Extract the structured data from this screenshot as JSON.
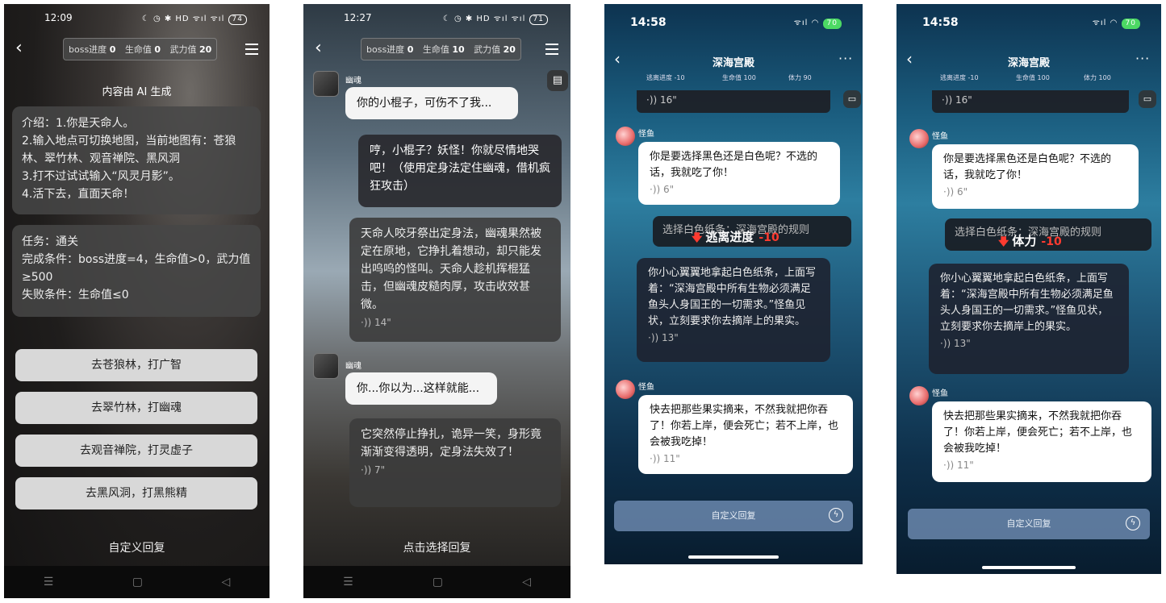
{
  "screen1": {
    "time": "12:09",
    "status_icons": "☾ ◷ ✱ HD ᯤıl ᯤıl",
    "battery": "74",
    "stats": {
      "boss_label": "boss进度",
      "boss": "0",
      "hp_label": "生命值",
      "hp": "0",
      "force_label": "武力值",
      "force": "20"
    },
    "ai_notice": "内容由 AI 生成",
    "intro": {
      "line1": "介绍：1.你是天命人。",
      "line2": "2.输入地点可切换地图，当前地图有：苍狼林、翠竹林、观音禅院、黑风洞",
      "line3": "3.打不过试试输入“风灵月影”。",
      "line4": "4.活下去，直面天命！"
    },
    "task": {
      "line1": "任务：通关",
      "line2": "完成条件：boss进度=4，生命值>0，武力值≥500",
      "line3": "失败条件：生命值≤0"
    },
    "options": [
      "去苍狼林，打广智",
      "去翠竹林，打幽魂",
      "去观音禅院，打灵虚子",
      "去黑风洞，打黑熊精"
    ],
    "custom_reply": "自定义回复"
  },
  "screen2": {
    "time": "12:27",
    "status_icons": "☾ ◷ ✱ HD ᯤıl ᯤıl",
    "battery": "71",
    "stats": {
      "boss_label": "boss进度",
      "boss": "0",
      "hp_label": "生命值",
      "hp": "10",
      "force_label": "武力值",
      "force": "20"
    },
    "messages": [
      {
        "speaker": "幽魂",
        "text": "你的小棍子，可伤不了我..."
      },
      {
        "text": "哼，小棍子？妖怪！你就尽情地哭吧！（使用定身法定住幽魂，借机疯狂攻击）"
      },
      {
        "text": "天命人咬牙祭出定身法，幽魂果然被定在原地，它挣扎着想动，却只能发出呜呜的怪叫。天命人趁机挥棍猛击，但幽魂皮糙肉厚，攻击收效甚微。",
        "duration": "14\""
      },
      {
        "speaker": "幽魂",
        "text": "你...你以为...这样就能..."
      },
      {
        "text": "它突然停止挣扎，诡异一笑，身形竟渐渐变得透明，定身法失效了！",
        "duration": "7\""
      }
    ],
    "select_reply": "点击选择回复"
  },
  "screen3": {
    "time": "14:58",
    "battery": "70",
    "title": "深海宫殿",
    "stats": {
      "escape": "逃离进度 -10",
      "hp": "生命值 100",
      "stamina": "体力 90"
    },
    "top_duration": "16\"",
    "messages": [
      {
        "speaker": "怪鱼",
        "text": "你是要选择黑色还是白色呢？不选的话，我就吃了你！",
        "duration": "6\""
      },
      {
        "text": "你小心翼翼地拿起白色纸条，上面写着：“深海宫殿中所有生物必须满足鱼头人身国王的一切需求。”怪鱼见状，立刻要求你去摘岸上的果实。",
        "duration": "13\""
      },
      {
        "speaker": "怪鱼",
        "text": "快去把那些果实摘来，不然我就把你吞了！你若上岸，便会死亡；若不上岸，也会被我吃掉！",
        "duration": "11\""
      }
    ],
    "rule_strip": "选择白色纸条：深海宫殿的规则",
    "toast": {
      "label": "逃离进度",
      "delta": "-10"
    },
    "input_placeholder": "自定义回复"
  },
  "screen4": {
    "time": "14:58",
    "battery": "70",
    "title": "深海宫殿",
    "stats": {
      "escape": "逃离进度 -10",
      "hp": "生命值 100",
      "stamina": "体力 100"
    },
    "top_duration": "16\"",
    "messages": [
      {
        "speaker": "怪鱼",
        "text": "你是要选择黑色还是白色呢？不选的话，我就吃了你！",
        "duration": "6\""
      },
      {
        "text": "你小心翼翼地拿起白色纸条，上面写着：“深海宫殿中所有生物必须满足鱼头人身国王的一切需求。”怪鱼见状，立刻要求你去摘岸上的果实。",
        "duration": "13\""
      },
      {
        "speaker": "怪鱼",
        "text": "快去把那些果实摘来，不然我就把你吞了！你若上岸，便会死亡；若不上岸，也会被我吃掉！",
        "duration": "11\""
      }
    ],
    "rule_strip": "选择白色纸条：深海宫殿的规则",
    "toast": {
      "label": "体力",
      "delta": "-10"
    },
    "input_placeholder": "自定义回复"
  }
}
